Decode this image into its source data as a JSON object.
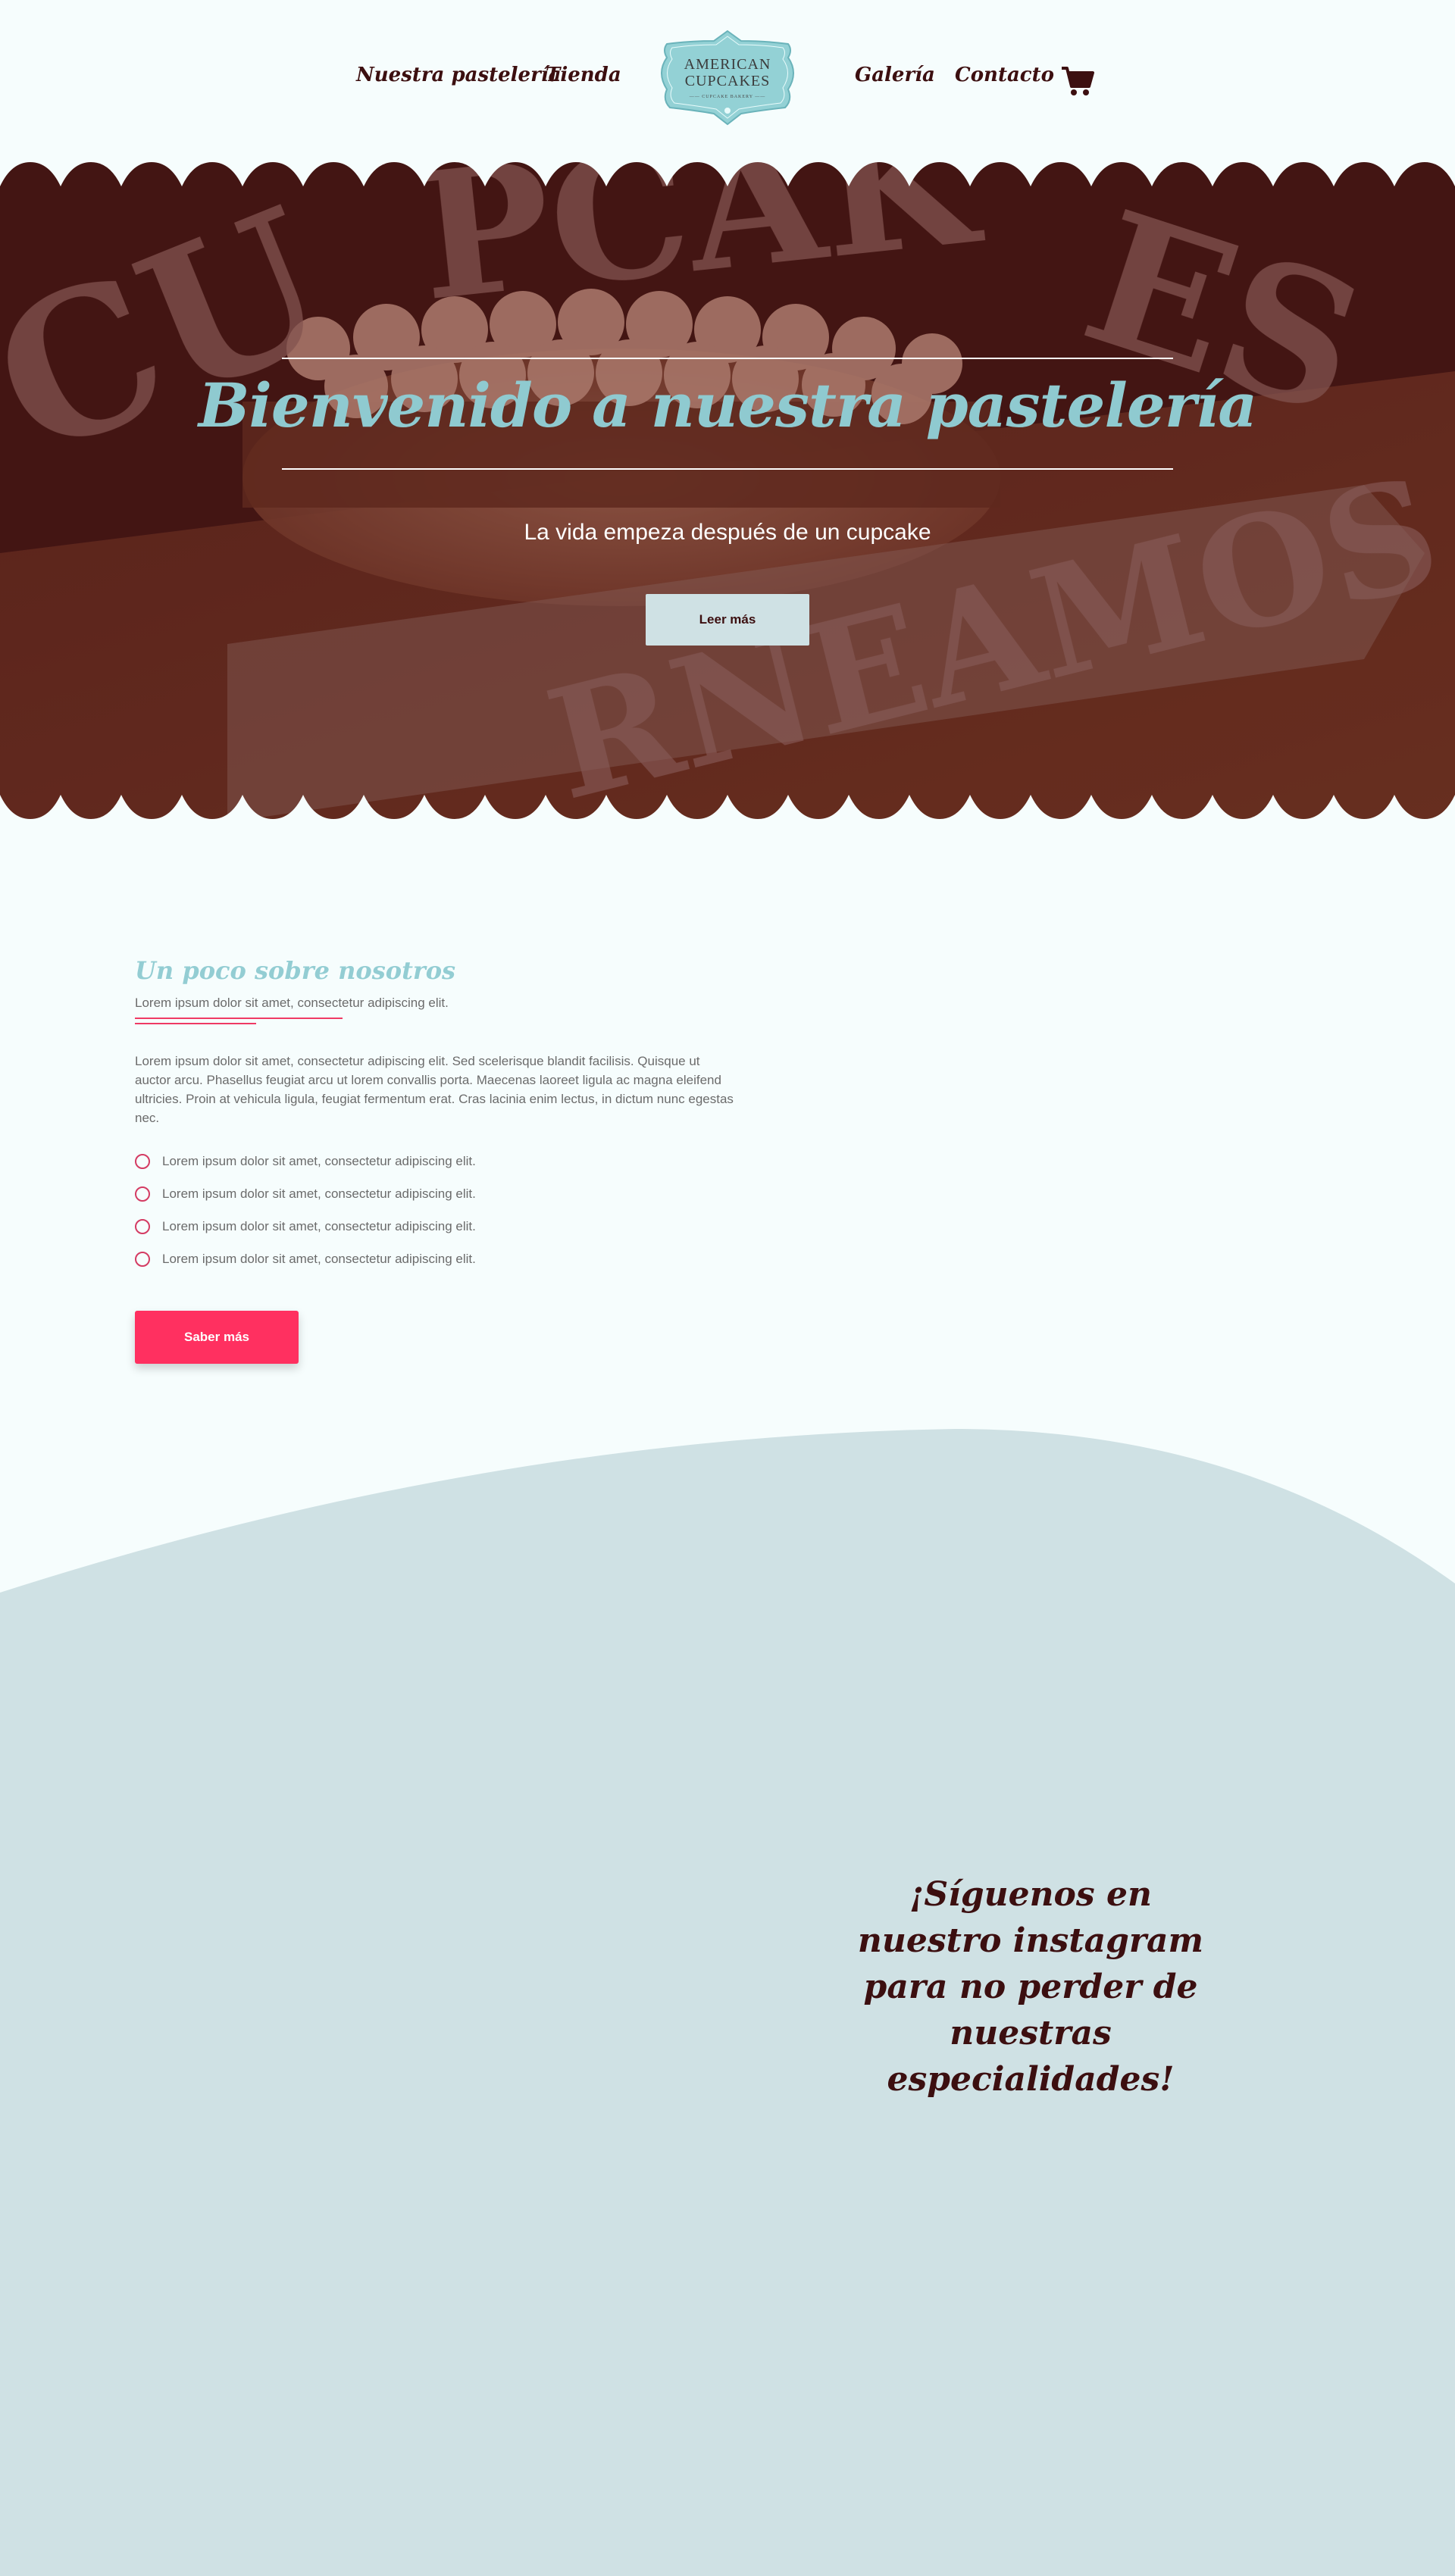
{
  "header": {
    "nav": [
      {
        "label": "Nuestra pastelería"
      },
      {
        "label": "Tienda"
      },
      {
        "label": "Galería"
      },
      {
        "label": "Contacto"
      }
    ],
    "logo": {
      "line1": "AMERICAN",
      "line2": "CUPCAKES",
      "line3": "—— CUPCAKE BAKERY ——"
    },
    "cart_icon": "shopping-cart-icon"
  },
  "hero": {
    "title": "Bienvenido a nuestra pastelería",
    "subtitle": "La vida empeza después de un cupcake",
    "button_label": "Leer más"
  },
  "about": {
    "title": "Un poco sobre nosotros",
    "tagline": "Lorem ipsum dolor sit amet, consectetur adipiscing elit.",
    "body": "Lorem ipsum dolor sit amet, consectetur adipiscing elit. Sed scelerisque blandit facilisis. Quisque ut auctor arcu. Phasellus feugiat arcu ut lorem convallis porta. Maecenas laoreet ligula ac magna eleifend ultricies. Proin at vehicula ligula, feugiat fermentum erat. Cras lacinia enim lectus, in dictum nunc egestas nec.",
    "list": [
      "Lorem ipsum dolor sit amet, consectetur adipiscing elit.",
      "Lorem ipsum dolor sit amet, consectetur adipiscing elit.",
      "Lorem ipsum dolor sit amet, consectetur adipiscing elit.",
      "Lorem ipsum dolor sit amet, consectetur adipiscing elit."
    ],
    "button_label": "Saber más"
  },
  "instagram": {
    "text": "¡Síguenos en nuestro instagram para no perder de nuestras especialidades!"
  },
  "colors": {
    "brand_dark": "#3c0f10",
    "accent_teal": "#8fcad0",
    "accent_pink": "#ff3060",
    "wave_bg": "#cfe1e4",
    "page_bg": "#f6fdfd"
  }
}
